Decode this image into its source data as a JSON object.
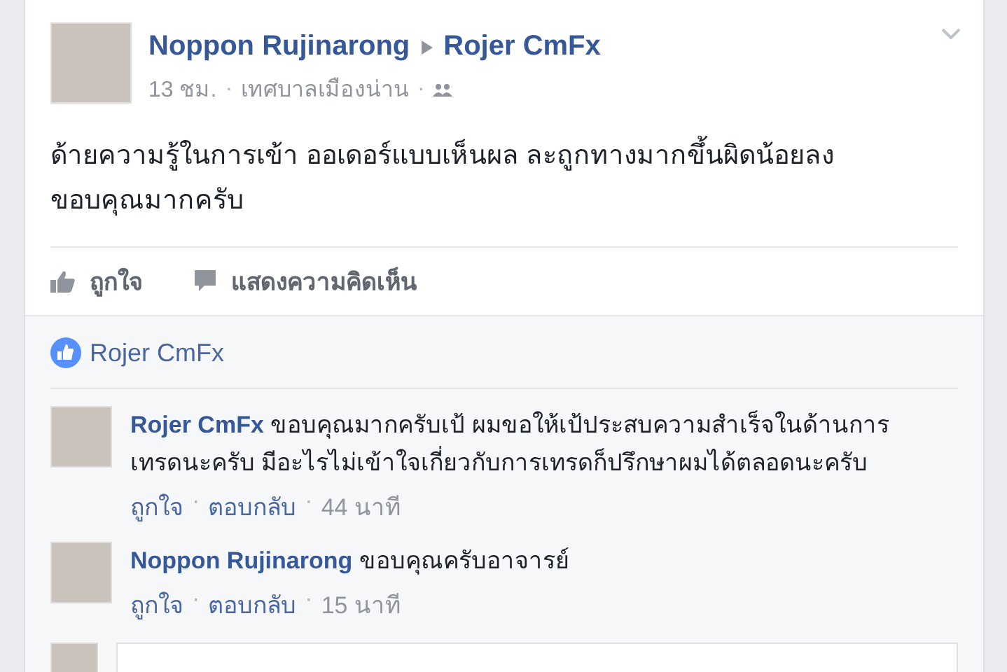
{
  "post": {
    "author": "Noppon Rujinarong",
    "target": "Rojer CmFx",
    "meta": [
      {
        "kind": "text",
        "text": "13 ชม."
      },
      {
        "kind": "separator",
        "text": "·"
      },
      {
        "kind": "text",
        "text": "เทศบาลเมืองน่าน"
      },
      {
        "kind": "separator",
        "text": "·"
      }
    ],
    "text": "ด้ายความรู้ในการเข้า ออเดอร์แบบเห็นผล ละถูกทางมากขึ้นผิดน้อยลง\nขอบคุณมากครับ",
    "actions": [
      {
        "kind": "like",
        "label": "ถูกใจ"
      },
      {
        "kind": "comment",
        "label": "แสดงความคิดเห็น"
      }
    ]
  },
  "likes": {
    "names": "Rojer CmFx"
  },
  "comments": [
    {
      "author": "Rojer CmFx",
      "text": "ขอบคุณมากครับเป้ ผมขอให้เป้ประสบความสำเร็จในด้านการเทรดนะครับ มีอะไรไม่เข้าใจเกี่ยวกับการเทรดก็ปรึกษาผมได้ตลอดนะครับ",
      "meta": [
        {
          "kind": "link",
          "text": "ถูกใจ"
        },
        {
          "kind": "separator",
          "text": "·"
        },
        {
          "kind": "link",
          "text": "ตอบกลับ"
        },
        {
          "kind": "separator",
          "text": "·"
        },
        {
          "kind": "time",
          "text": "44 นาที"
        }
      ]
    },
    {
      "author": "Noppon Rujinarong",
      "text": "ขอบคุณครับอาจารย์",
      "meta": [
        {
          "kind": "link",
          "text": "ถูกใจ"
        },
        {
          "kind": "separator",
          "text": "·"
        },
        {
          "kind": "link",
          "text": "ตอบกลับ"
        },
        {
          "kind": "separator",
          "text": "·"
        },
        {
          "kind": "time",
          "text": "15 นาที"
        }
      ]
    }
  ]
}
